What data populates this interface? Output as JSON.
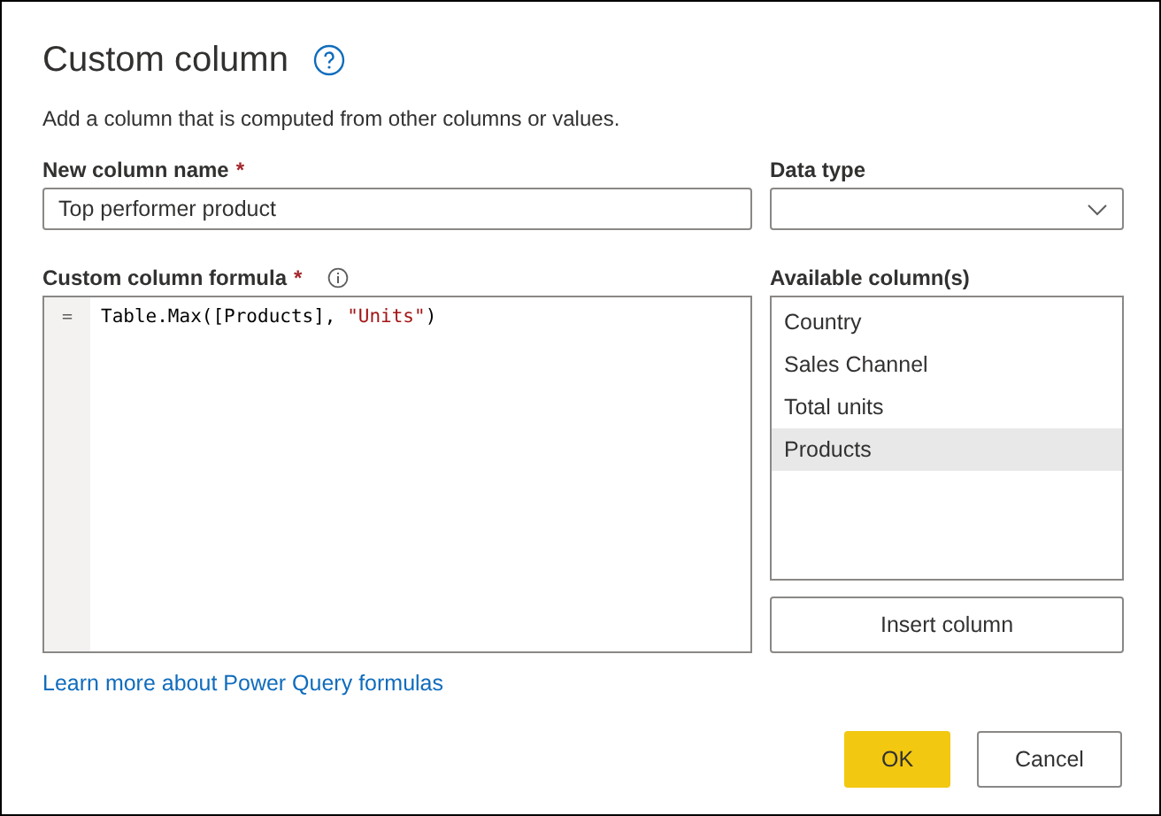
{
  "dialog": {
    "title": "Custom column",
    "description": "Add a column that is computed from other columns or values."
  },
  "name_field": {
    "label": "New column name",
    "required_mark": "*",
    "value": "Top performer product"
  },
  "data_type": {
    "label": "Data type"
  },
  "formula": {
    "label": "Custom column formula",
    "required_mark": "*",
    "gutter": "=",
    "tokens": [
      {
        "text": "Table.Max([Products], ",
        "kind": "code"
      },
      {
        "text": "\"Units\"",
        "kind": "string"
      },
      {
        "text": ")",
        "kind": "code"
      }
    ]
  },
  "available_columns": {
    "label": "Available column(s)",
    "items": [
      {
        "label": "Country",
        "selected": false
      },
      {
        "label": "Sales Channel",
        "selected": false
      },
      {
        "label": "Total units",
        "selected": false
      },
      {
        "label": "Products",
        "selected": true
      }
    ]
  },
  "insert_button": "Insert column",
  "learn_link": "Learn more about Power Query formulas",
  "buttons": [
    {
      "label": "OK",
      "kind": "primary"
    },
    {
      "label": "Cancel",
      "kind": "secondary"
    }
  ]
}
